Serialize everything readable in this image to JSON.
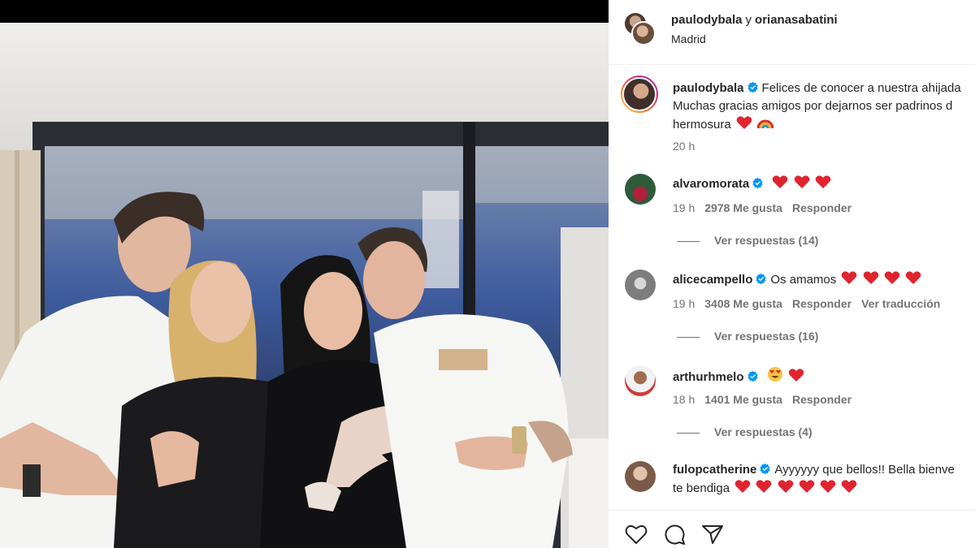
{
  "post": {
    "header": {
      "user1": "paulodybala",
      "separator": "y",
      "user2": "orianasabatini",
      "location": "Madrid"
    },
    "caption": {
      "user": "paulodybala",
      "line1": "Felices de conocer a nuestra ahijada",
      "line2": "Muchas gracias amigos por dejarnos ser padrinos d",
      "line3": "hermosura",
      "time": "20 h"
    },
    "comments": [
      {
        "user": "alvaromorata",
        "text": "",
        "time": "19 h",
        "likes": "2978 Me gusta",
        "reply": "Responder",
        "translate": "",
        "replies": "Ver respuestas (14)"
      },
      {
        "user": "alicecampello",
        "text": "Os amamos",
        "time": "19 h",
        "likes": "3408 Me gusta",
        "reply": "Responder",
        "translate": "Ver traducción",
        "replies": "Ver respuestas (16)"
      },
      {
        "user": "arthurhmelo",
        "text": "",
        "time": "18 h",
        "likes": "1401 Me gusta",
        "reply": "Responder",
        "translate": "",
        "replies": "Ver respuestas (4)"
      },
      {
        "user": "fulopcatherine",
        "text": "Ayyyyyy que bellos!! Bella bienve",
        "text2": "te bendiga"
      }
    ]
  },
  "icons": [
    "verified-badge-icon",
    "heart-emoji-icon",
    "rainbow-emoji-icon",
    "heart-eyes-emoji-icon",
    "like-icon",
    "comment-icon",
    "share-icon"
  ],
  "colors": {
    "verified": "#0095f6",
    "heart": "#e0242f",
    "muted": "#737373",
    "text": "#262626"
  }
}
